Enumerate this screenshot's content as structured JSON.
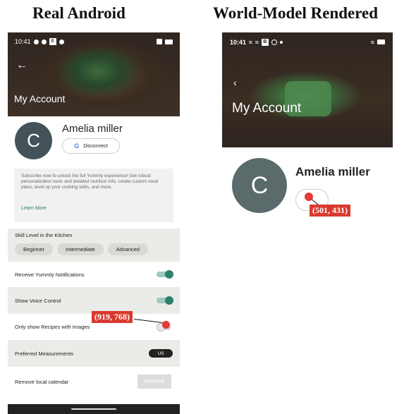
{
  "headings": {
    "left": "Real Android",
    "right": "World-Model Rendered"
  },
  "left": {
    "status_time": "10:41",
    "status_b": "B",
    "back_arrow": "←",
    "title": "My Account",
    "avatar_letter": "C",
    "name": "Amelia miller",
    "google_letter": "G",
    "disconnect_label": "Disconnect",
    "promo_text": "Subscribe now to unlock the full Yummly experience! Get robust personalization tools and detailed nutrition info, create custom meal plans, level up your cooking skills, and more.",
    "learn_more": "Learn More",
    "skill_label": "Skill Level in the Kitchen",
    "skill_options": [
      "Beginner",
      "Intermediate",
      "Advanced"
    ],
    "notifications_label": "Receive Yummly Notifications",
    "voice_label": "Show Voice Control",
    "images_label": "Only show Recipes with Images",
    "measure_label": "Preferred Measurements",
    "measure_value": "US",
    "calendar_label": "Remove local calendar",
    "remove_label": "REMOVE",
    "click_coord": "(919, 768)"
  },
  "right": {
    "status_time": "10:41",
    "status_b": "B",
    "back_arrow": "‹",
    "title": "My Account",
    "avatar_letter": "C",
    "name": "Amelia miller",
    "click_coord": "(501, 431)"
  },
  "colors": {
    "accent_teal": "#2f7f6d",
    "click_marker": "#e53935",
    "badge": "#d93a2f"
  }
}
